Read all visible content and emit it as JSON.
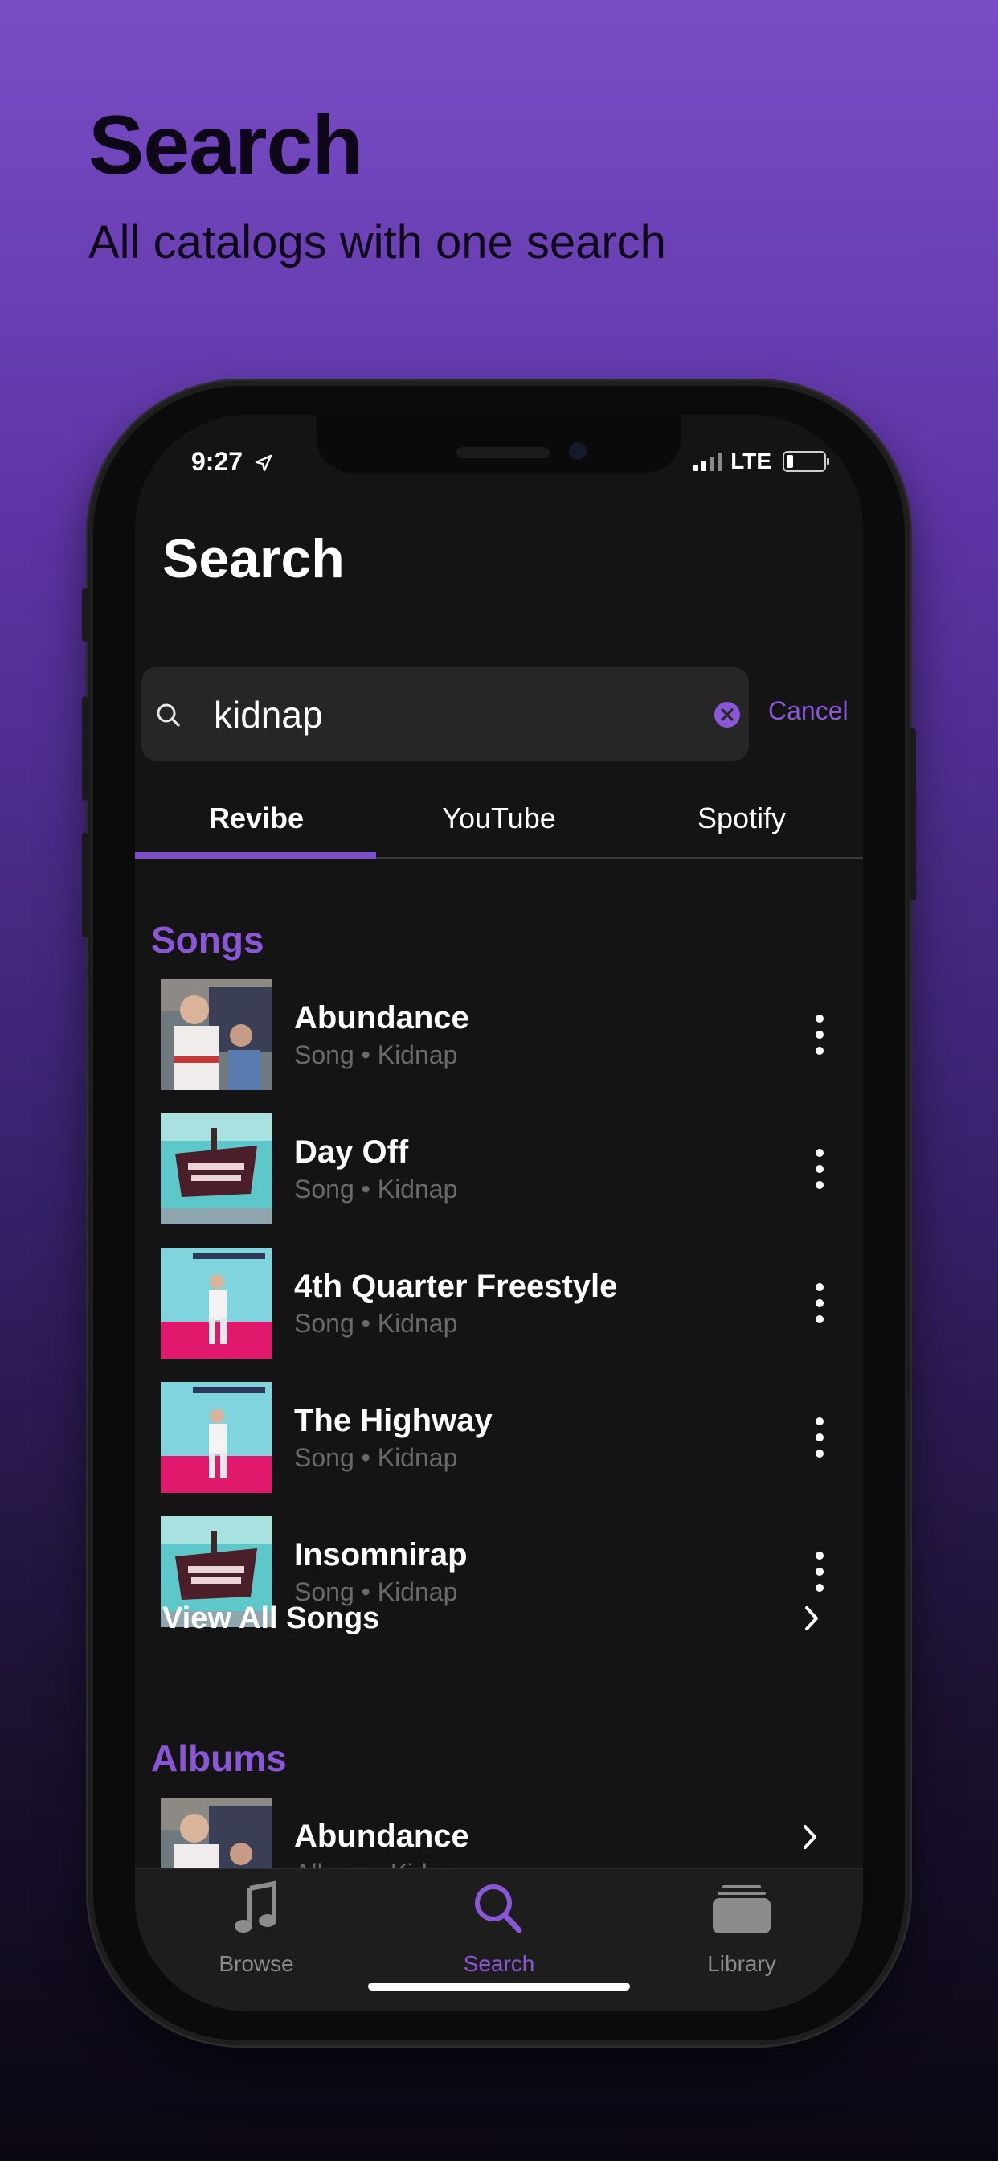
{
  "promo": {
    "title": "Search",
    "subtitle": "All catalogs with one search"
  },
  "status_bar": {
    "time": "9:27",
    "network": "LTE",
    "battery_level": 0.2
  },
  "screen": {
    "title": "Search"
  },
  "search": {
    "query": "kidnap",
    "cancel_label": "Cancel"
  },
  "tabs": [
    {
      "label": "Revibe",
      "active": true
    },
    {
      "label": "YouTube",
      "active": false
    },
    {
      "label": "Spotify",
      "active": false
    }
  ],
  "songs_section": {
    "title": "Songs",
    "items": [
      {
        "title": "Abundance",
        "subtitle": "Song • Kidnap",
        "art": "portrait"
      },
      {
        "title": "Day Off",
        "subtitle": "Song • Kidnap",
        "art": "cyan-city"
      },
      {
        "title": "4th Quarter Freestyle",
        "subtitle": "Song • Kidnap",
        "art": "bright-colors"
      },
      {
        "title": "The Highway",
        "subtitle": "Song • Kidnap",
        "art": "bright-colors"
      },
      {
        "title": "Insomnirap",
        "subtitle": "Song • Kidnap",
        "art": "cyan-city"
      }
    ],
    "view_all_label": "View All Songs"
  },
  "albums_section": {
    "title": "Albums",
    "items": [
      {
        "title": "Abundance",
        "subtitle": "Album • Kidnap",
        "art": "portrait"
      }
    ]
  },
  "tab_bar": {
    "items": [
      {
        "label": "Browse",
        "icon": "music-note-icon",
        "active": false
      },
      {
        "label": "Search",
        "icon": "search-icon",
        "active": true
      },
      {
        "label": "Library",
        "icon": "library-stack-icon",
        "active": false
      }
    ]
  },
  "colors": {
    "accent": "#8a57d6",
    "screen_bg": "#141414",
    "tab_bar_bg": "#1d1d1d"
  }
}
